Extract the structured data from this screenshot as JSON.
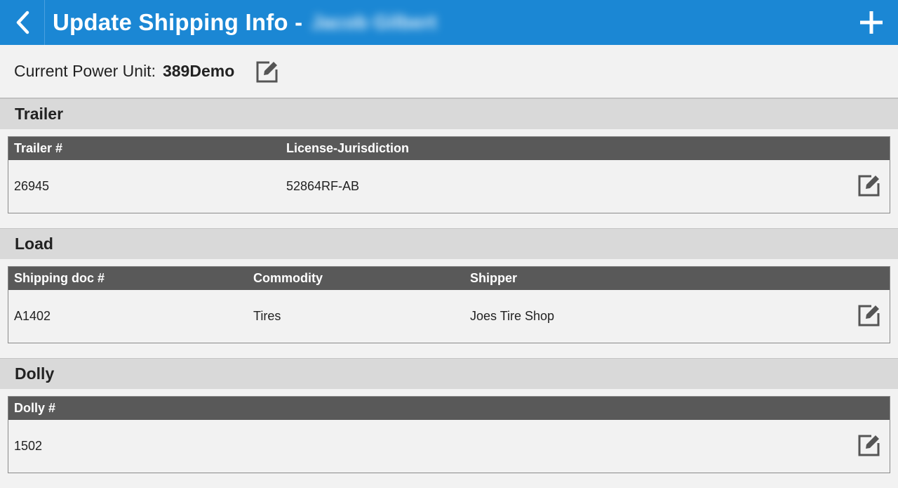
{
  "appbar": {
    "title": "Update Shipping Info -",
    "driver_name": "Jacob Gilbert",
    "back_icon": "chevron-left-icon",
    "add_icon": "plus-icon",
    "color": "#1b87d4"
  },
  "power_unit": {
    "label": "Current Power Unit:",
    "value": "389Demo",
    "edit_icon": "edit-icon"
  },
  "trailer": {
    "title": "Trailer",
    "headers": [
      "Trailer #",
      "License-Jurisdiction"
    ],
    "row": [
      "26945",
      "52864RF-AB"
    ]
  },
  "load": {
    "title": "Load",
    "headers": [
      "Shipping doc #",
      "Commodity",
      "Shipper"
    ],
    "row": [
      "A1402",
      "Tires",
      "Joes Tire Shop"
    ]
  },
  "dolly": {
    "title": "Dolly",
    "headers": [
      "Dolly #"
    ],
    "row": [
      "1502"
    ]
  }
}
